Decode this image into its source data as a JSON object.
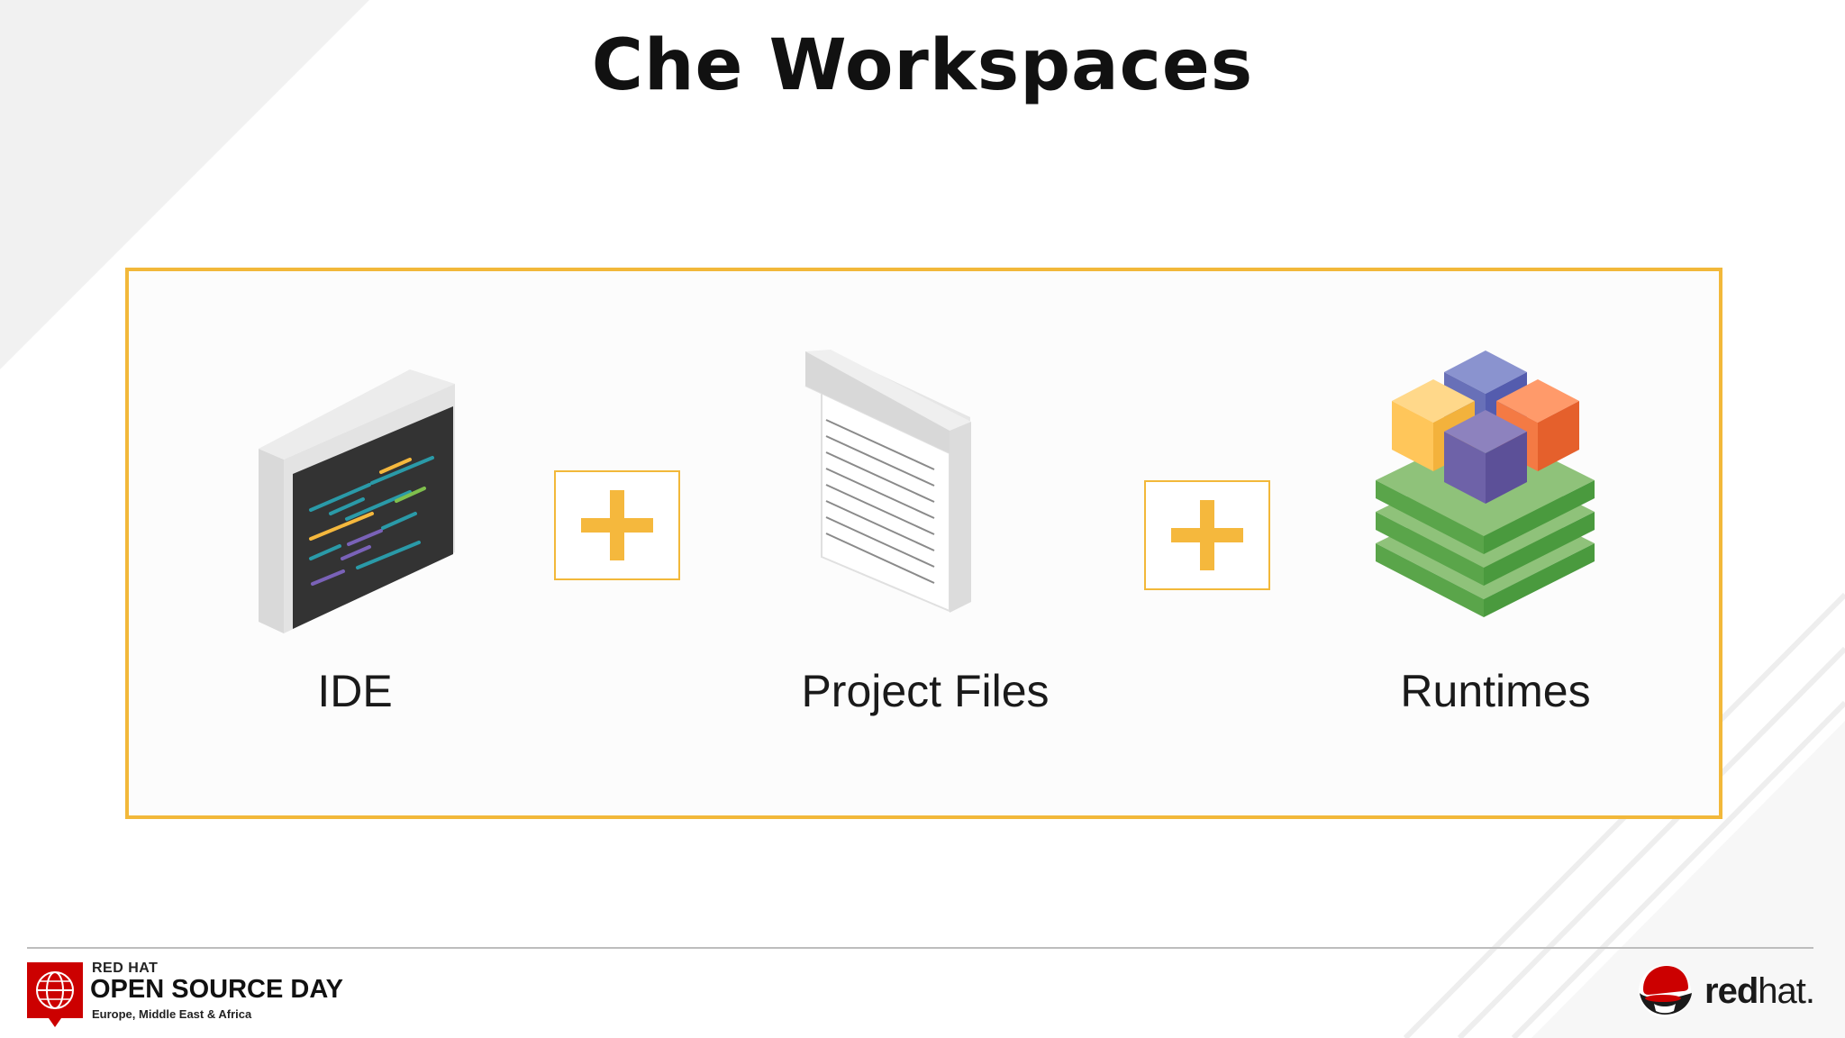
{
  "slide": {
    "title": "Che Workspaces"
  },
  "components": [
    {
      "label": "IDE",
      "icon": "ide-screen-icon"
    },
    {
      "label": "Project Files",
      "icon": "document-icon"
    },
    {
      "label": "Runtimes",
      "icon": "stacked-blocks-icon"
    }
  ],
  "operators": [
    "plus-icon",
    "plus-icon"
  ],
  "footer": {
    "event_small": "RED HAT",
    "event_big": "OPEN SOURCE DAY",
    "event_sub": "Europe, Middle East & Africa",
    "brand_bold": "red",
    "brand_light": "hat."
  },
  "colors": {
    "frame_border": "#f2b83a",
    "plus": "#f5b83d",
    "brand_red": "#cc0000"
  }
}
